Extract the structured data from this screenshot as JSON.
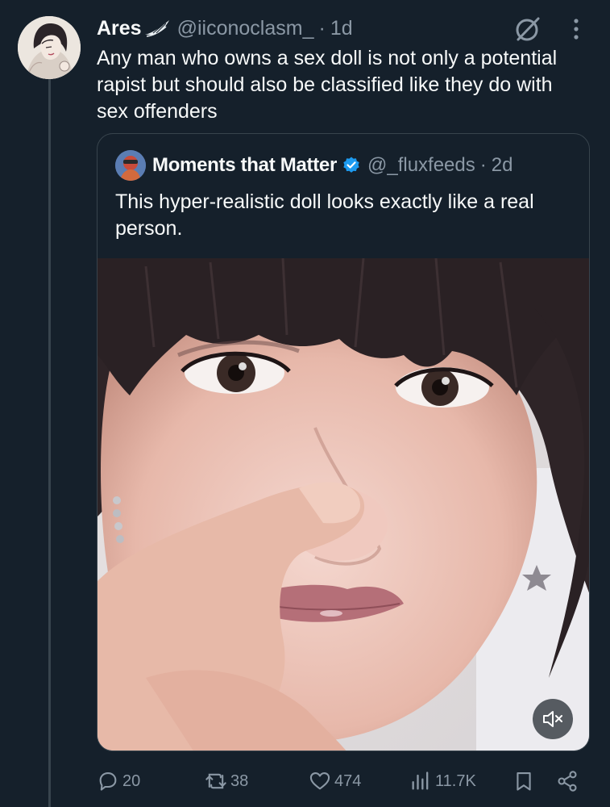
{
  "tweet": {
    "author_name": "Ares",
    "author_handle": "@iiconoclasm_",
    "separator": "·",
    "time": "1d",
    "text": "Any man who owns a sex doll is not only a potential rapist but should also be classified like they do with sex offenders",
    "icons": {
      "name_badge": "wing-icon",
      "grok": "grok-icon",
      "more": "more-options-icon"
    }
  },
  "quote": {
    "author_name": "Moments that Matter",
    "author_handle": "@_fluxfeeds",
    "separator": "·",
    "time": "2d",
    "text": "This hyper-realistic doll looks exactly like a real person.",
    "verified": true,
    "media": {
      "type": "video",
      "muted": true
    }
  },
  "actions": {
    "reply_count": "20",
    "retweet_count": "38",
    "like_count": "474",
    "view_count": "11.7K"
  },
  "colors": {
    "background": "#15202b",
    "text_primary": "#f7f9f9",
    "text_secondary": "#8b98a5",
    "border": "#38444d",
    "verified": "#1d9bf0"
  }
}
